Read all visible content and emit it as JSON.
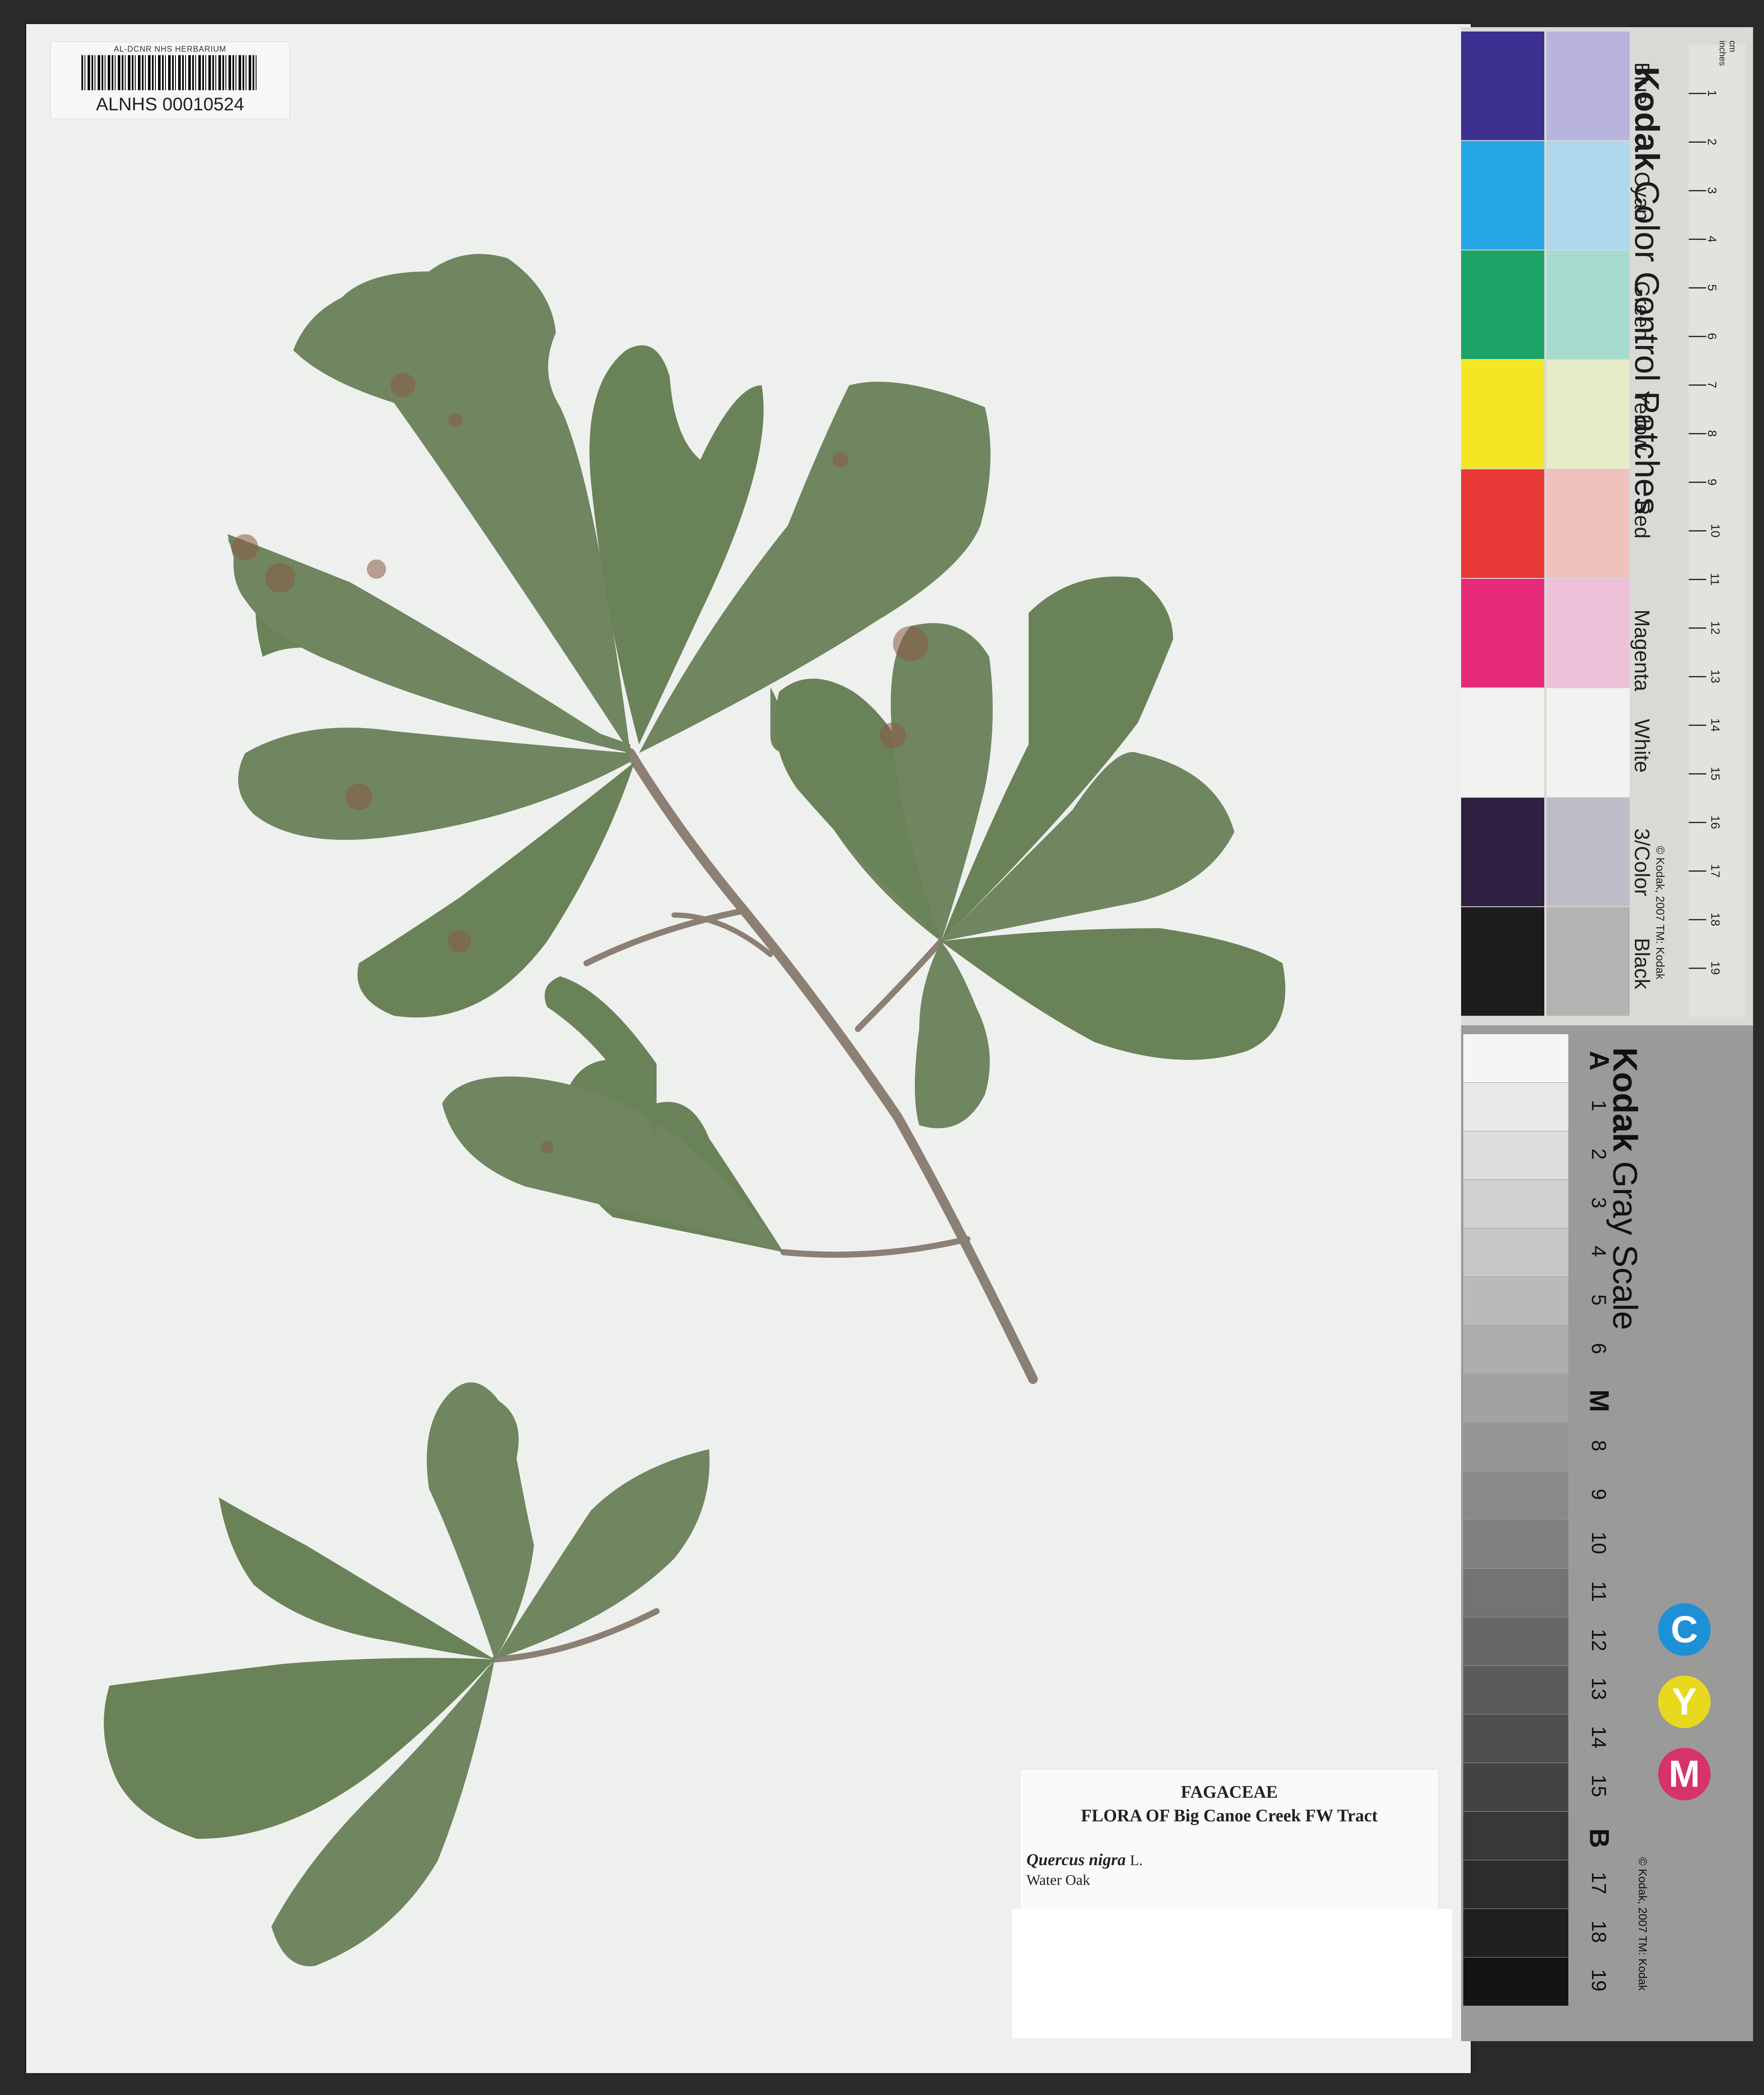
{
  "barcode": {
    "institution": "AL-DCNR NHS HERBARIUM",
    "number": "ALNHS 00010524"
  },
  "label": {
    "family": "FAGACEAE",
    "flora": "FLORA OF Big Canoe Creek FW Tract",
    "scientific_name": "Quercus nigra",
    "author": "L.",
    "common_name": "Water Oak"
  },
  "color_chart": {
    "title_brand": "Kodak",
    "title_rest": "Color Control Patches",
    "patches": [
      {
        "name": "Blue",
        "dark": "#3b2f8f",
        "light": "#b9b3e0"
      },
      {
        "name": "Cyan",
        "dark": "#27a6e6",
        "light": "#b0d8ec"
      },
      {
        "name": "Green",
        "dark": "#1da567",
        "light": "#a8dbd0"
      },
      {
        "name": "Yellow",
        "dark": "#f4e624",
        "light": "#e8ebc8"
      },
      {
        "name": "Red",
        "dark": "#e83a36",
        "light": "#efc2bd"
      },
      {
        "name": "Magenta",
        "dark": "#e62a7a",
        "light": "#eec1d8"
      },
      {
        "name": "White",
        "dark": "#f2f2f0",
        "light": "#f2f2f0"
      },
      {
        "name": "3/Color",
        "dark": "#2e2040",
        "light": "#bdbcc8"
      },
      {
        "name": "Black",
        "dark": "#1c1c1c",
        "light": "#b3b3b1"
      }
    ],
    "copyright": "© Kodak, 2007 TM: Kodak",
    "ruler_units": [
      "cm",
      "inches"
    ],
    "ruler_cm": [
      "1",
      "2",
      "3",
      "4",
      "5",
      "6",
      "7",
      "8",
      "9",
      "10",
      "11",
      "12",
      "13",
      "14",
      "15",
      "16",
      "17",
      "18",
      "19"
    ]
  },
  "gray_scale": {
    "title_brand": "Kodak",
    "title_rest": "Gray Scale",
    "steps": [
      "A",
      "1",
      "2",
      "3",
      "4",
      "5",
      "6",
      "M",
      "8",
      "9",
      "10",
      "11",
      "12",
      "13",
      "14",
      "15",
      "B",
      "17",
      "18",
      "19"
    ],
    "cym": [
      {
        "letter": "C",
        "color": "#1e90d6"
      },
      {
        "letter": "Y",
        "color": "#e8d81e"
      },
      {
        "letter": "M",
        "color": "#d6336a"
      }
    ],
    "copyright": "© Kodak, 2007 TM: Kodak"
  },
  "specimen": {
    "leaf_color": "#6f8660",
    "leaf_dark": "#5e7652",
    "stem_color": "#8c7f74",
    "spot_color": "#8a5a45"
  }
}
